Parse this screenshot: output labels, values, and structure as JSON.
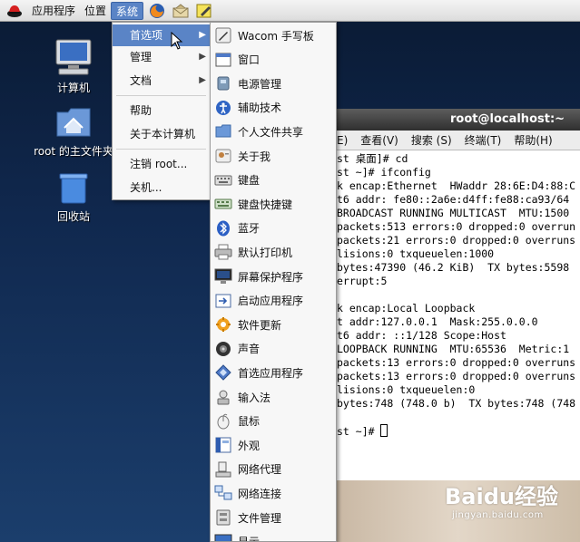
{
  "panel": {
    "menus": [
      "应用程序",
      "位置",
      "系统"
    ]
  },
  "desktop": {
    "icons": [
      {
        "label": "计算机",
        "icon": "computer-icon"
      },
      {
        "label": "root 的主文件夹",
        "icon": "home-folder-icon"
      },
      {
        "label": "回收站",
        "icon": "trash-icon"
      }
    ]
  },
  "system_menu": {
    "items": [
      "首选项",
      "管理",
      "文档",
      "帮助",
      "关于本计算机",
      "注销 root...",
      "关机..."
    ]
  },
  "preferences_menu": {
    "items": [
      {
        "label": "Wacom 手写板",
        "icon": "pen-tablet-icon"
      },
      {
        "label": "窗口",
        "icon": "window-icon"
      },
      {
        "label": "电源管理",
        "icon": "power-icon"
      },
      {
        "label": "辅助技术",
        "icon": "accessibility-icon"
      },
      {
        "label": "个人文件共享",
        "icon": "file-sharing-icon"
      },
      {
        "label": "关于我",
        "icon": "about-me-icon"
      },
      {
        "label": "键盘",
        "icon": "keyboard-icon"
      },
      {
        "label": "键盘快捷键",
        "icon": "keyboard-shortcuts-icon"
      },
      {
        "label": "蓝牙",
        "icon": "bluetooth-icon"
      },
      {
        "label": "默认打印机",
        "icon": "printer-icon"
      },
      {
        "label": "屏幕保护程序",
        "icon": "screensaver-icon"
      },
      {
        "label": "启动应用程序",
        "icon": "startup-apps-icon"
      },
      {
        "label": "软件更新",
        "icon": "software-update-icon"
      },
      {
        "label": "声音",
        "icon": "sound-icon"
      },
      {
        "label": "首选应用程序",
        "icon": "preferred-apps-icon"
      },
      {
        "label": "输入法",
        "icon": "input-method-icon"
      },
      {
        "label": "鼠标",
        "icon": "mouse-icon"
      },
      {
        "label": "外观",
        "icon": "appearance-icon"
      },
      {
        "label": "网络代理",
        "icon": "network-proxy-icon"
      },
      {
        "label": "网络连接",
        "icon": "network-connections-icon"
      },
      {
        "label": "文件管理",
        "icon": "file-management-icon"
      },
      {
        "label": "显示",
        "icon": "display-icon"
      }
    ]
  },
  "terminal": {
    "title": "root@localhost:~",
    "menus": [
      "E)",
      "查看(V)",
      "搜索 (S)",
      "终端(T)",
      "帮助(H)"
    ],
    "lines": [
      "st 桌面]# cd",
      "st ~]# ifconfig",
      "k encap:Ethernet  HWaddr 28:6E:D4:88:C",
      "t6 addr: fe80::2a6e:d4ff:fe88:ca93/64",
      "BROADCAST RUNNING MULTICAST  MTU:1500",
      "packets:513 errors:0 dropped:0 overrun",
      "packets:21 errors:0 dropped:0 overruns",
      "lisions:0 txqueuelen:1000",
      "bytes:47390 (46.2 KiB)  TX bytes:5598",
      "errupt:5",
      "",
      "k encap:Local Loopback",
      "t addr:127.0.0.1  Mask:255.0.0.0",
      "t6 addr: ::1/128 Scope:Host",
      "LOOPBACK RUNNING  MTU:65536  Metric:1",
      "packets:13 errors:0 dropped:0 overruns",
      "packets:13 errors:0 dropped:0 overruns",
      "lisions:0 txqueuelen:0",
      "bytes:748 (748.0 b)  TX bytes:748 (748",
      "",
      "st ~]# "
    ]
  },
  "watermark": {
    "brand": "Baidu经验",
    "url": "jingyan.baidu.com"
  },
  "colors": {
    "menu_highlight": "#5a84c6",
    "terminal_title": "#3a3a3a"
  }
}
